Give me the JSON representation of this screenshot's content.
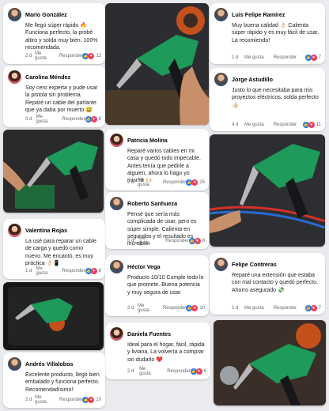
{
  "ui": {
    "like_label": "Me gusta",
    "reply_label": "Responder"
  },
  "colors": {
    "like": "#1877f2",
    "love": "#f33e58",
    "tool_green": "#1e9a5a",
    "background": "#e9ebee"
  },
  "comments": [
    {
      "name": "Mario González",
      "text": "Me llegó súper rápido 🔥 Funciona perfecto, la probé altiro y solda muy bien. 100% recomendada.",
      "time": "2 d",
      "count": "12",
      "reactions": [
        "like",
        "love"
      ]
    },
    {
      "name": "Luis Felipe Ramírez",
      "text": "Muy buena calidad 👌🏻 Calienta súper rápido y es muy fácil de usar. La recomiendo!",
      "time": "1 d",
      "count": "7",
      "reactions": [
        "like",
        "love"
      ]
    },
    {
      "name": "Carolina Méndez",
      "text": "Soy cero experta y pude usar la pistola sin problema. Reparé un cable del parlante que ya daba por muerto 😅",
      "time": "3 d",
      "count": "9",
      "reactions": [
        "like",
        "love"
      ]
    },
    {
      "name": "Jorge Astudillo",
      "text": "Justo lo que necesitaba para mis proyectos eléctricos, solda perfecto 👍🏻",
      "time": "4 d",
      "count": "11",
      "reactions": [
        "like",
        "love"
      ]
    },
    {
      "name": "Patricia Molina",
      "text": "Reparé varios cables en mi casa y quedó todo impecable. Antes tenía que pedirle a alguien, ahora lo hago yo misma 🙌🏻",
      "time": "2 d",
      "count": "15",
      "reactions": [
        "like",
        "love"
      ]
    },
    {
      "name": "Roberto Sanhueza",
      "text": "Pensé que sería más complicada de usar, pero es súper simple. Calienta en segundos y el resultado es increíble.",
      "time": "5 d",
      "count": "8",
      "reactions": [
        "like",
        "love"
      ]
    },
    {
      "name": "Valentina Rojas",
      "text": "La usé para reparar un cable de carga y quedó como nuevo. Me encantó, es muy práctica 👌🏻📱",
      "time": "1 d",
      "count": "6",
      "reactions": [
        "like",
        "love"
      ]
    },
    {
      "name": "Héctor Vega",
      "text": "Producto 10/10 Cumple todo lo que promete. Buena potencia y muy segura de usar.",
      "time": "3 d",
      "count": "10",
      "reactions": [
        "like",
        "love"
      ]
    },
    {
      "name": "Felipe Contreras",
      "text": "Reparé una extensión que estaba con mal contacto y quedó perfecto. Ahorro asegurado 💸",
      "time": "1 d",
      "count": "7",
      "reactions": [
        "like",
        "love"
      ]
    },
    {
      "name": "Daniela Fuentes",
      "text": "Ideal para el hogar, fácil, rápida y liviana. La volvería a comprar sin dudarlo ❤️",
      "time": "2 d",
      "count": "6",
      "reactions": [
        "like",
        "love"
      ]
    },
    {
      "name": "Andrés Villalobos",
      "text": "Excelente producto, llegó bien embalado y funciona perfecto. Recomendadísimo!",
      "time": "2 d",
      "count": "10",
      "reactions": [
        "like",
        "love"
      ]
    }
  ]
}
